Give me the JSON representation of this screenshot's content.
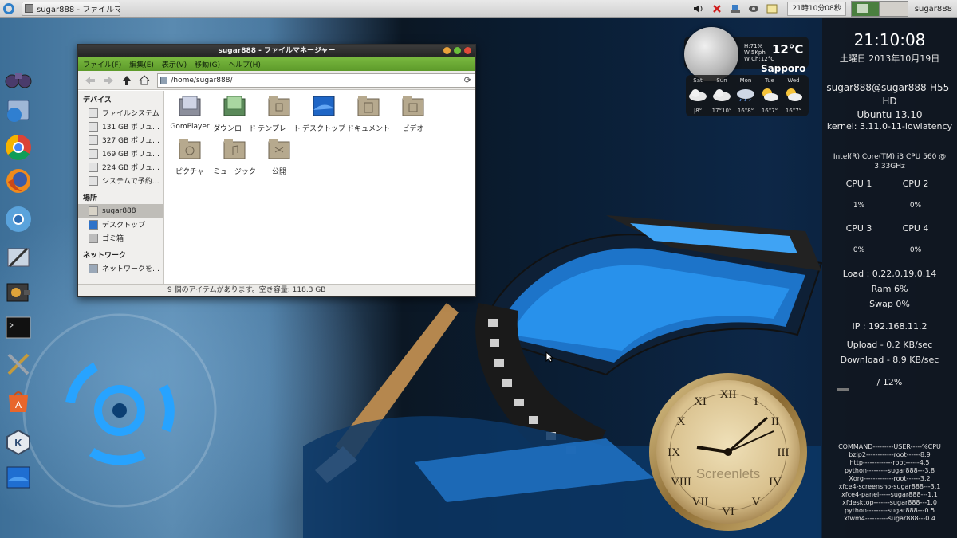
{
  "top_panel": {
    "task_title": "sugar888 - ファイルマネ…",
    "clock": "21時10分08秒",
    "user": "sugar888",
    "tray_icons": [
      "volume-icon",
      "network-disconnected-icon",
      "network-icon",
      "screenshot-icon",
      "indicator-icon"
    ]
  },
  "dock": {
    "items": [
      "binoculars-icon",
      "file-manager-icon",
      "chrome-icon",
      "firefox-icon",
      "chromium-icon",
      "graphics-editor-icon",
      "media-player-icon",
      "terminal-icon",
      "settings-tools-icon",
      "software-center-icon",
      "k-launcher-icon",
      "desktop-icon"
    ]
  },
  "file_manager": {
    "title": "sugar888 - ファイルマネージャー",
    "menu": [
      "ファイル(F)",
      "編集(E)",
      "表示(V)",
      "移動(G)",
      "ヘルプ(H)"
    ],
    "location": "/home/sugar888/",
    "sidebar": {
      "devices_header": "デバイス",
      "devices": [
        "ファイルシステム",
        "131 GB ボリュ…",
        "327 GB ボリュ…",
        "169 GB ボリュ…",
        "224 GB ボリュ…",
        "システムで予約…"
      ],
      "places_header": "場所",
      "places": [
        "sugar888",
        "デスクトップ",
        "ゴミ箱"
      ],
      "network_header": "ネットワーク",
      "network": [
        "ネットワークを…"
      ]
    },
    "files": [
      "GomPlayer",
      "ダウンロード",
      "テンプレート",
      "デスクトップ",
      "ドキュメント",
      "ビデオ",
      "ピクチャ",
      "ミュージック",
      "公開"
    ],
    "status": "9 個のアイテムがあります。空き容量: 118.3 GB"
  },
  "weather": {
    "humidity": "H:71%",
    "wind": "W:5Kph",
    "windchill": "W Ch:12°C",
    "temperature": "12°C",
    "city": "Sapporo",
    "forecast": [
      {
        "day": "Sat",
        "range": "|8°"
      },
      {
        "day": "Sun",
        "range": "17°10°"
      },
      {
        "day": "Mon",
        "range": "16°8°"
      },
      {
        "day": "Tue",
        "range": "16°7°"
      },
      {
        "day": "Wed",
        "range": "16°7°"
      }
    ]
  },
  "system_panel": {
    "time": "21:10:08",
    "date": "土曜日 2013年10月19日",
    "host": "sugar888@sugar888-H55-HD",
    "os": "Ubuntu 13.10",
    "kernel": "kernel: 3.11.0-11-lowlatency",
    "cpu_name": "Intel(R) Core(TM) i3 CPU       560  @ 3.33GHz",
    "cpus": [
      {
        "label": "CPU 1",
        "value": "1%"
      },
      {
        "label": "CPU 2",
        "value": "0%"
      },
      {
        "label": "CPU 3",
        "value": "0%"
      },
      {
        "label": "CPU 4",
        "value": "0%"
      }
    ],
    "load": "Load : 0.22,0.19,0.14",
    "ram": "Ram 6%",
    "swap": "Swap 0%",
    "ip": "IP : 192.168.11.2",
    "upload": "Upload - 0.2 KB/sec",
    "download": "Download - 8.9 KB/sec",
    "disk": "/ 12%",
    "process_header": "COMMAND---------USER-----%CPU",
    "processes": [
      "bzip2------------root------8.9",
      "http-------------root------4.5",
      "python---------sugar888---3.8",
      "Xorg-------------root------3.2",
      "xfce4-screensho-sugar888---3.1",
      "xfce4-panel-----sugar888---1.1",
      "xfdesktop-------sugar888---1.0",
      "python---------sugar888---0.5",
      "xfwm4----------sugar888---0.4"
    ]
  },
  "clock_screenlet": {
    "watermark": "Screenlets"
  },
  "colors": {
    "menubar_green": "#6aa832",
    "panel_bg": "#d8d8d8",
    "wallpaper_blue": "#1f7fd6"
  }
}
